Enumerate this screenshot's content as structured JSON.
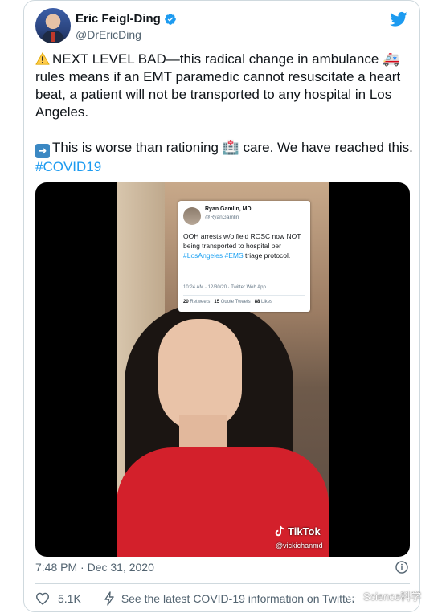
{
  "tweet": {
    "author_name": "Eric Feigl-Ding",
    "author_handle": "@DrEricDing",
    "paragraph1": "NEXT LEVEL BAD—this radical change in ambulance 🚑 rules means if an EMT paramedic cannot resuscitate a heart beat, a patient will not be transported to any hospital in Los Angeles.",
    "paragraph2_a": "This is worse than rationing 🏥 care. We have reached this. ",
    "hashtag": "#COVID19",
    "timestamp": "7:48 PM · Dec 31, 2020",
    "likes": "5.1K",
    "covid_link": "See the latest COVID-19 information on Twitter"
  },
  "embedded_tweet": {
    "name": "Ryan Gamlin, MD",
    "handle": "@RyanGamlin",
    "text_a": "OOH arrests w/o field ROSC now NOT being transported to hospital per ",
    "hashtag1": "#LosAngeles",
    "hashtag2": "#EMS",
    "text_b": " triage protocol.",
    "time": "10:24 AM · 12/30/20 · Twitter Web App",
    "retweets": "20",
    "retweets_label": "Retweets",
    "quotes": "15",
    "quotes_label": "Quote Tweets",
    "likes": "88",
    "likes_label": "Likes"
  },
  "video_overlay": {
    "tiktok_label": "TikTok",
    "tiktok_handle": "@vickichanmd"
  },
  "watermark": "Science科学",
  "colors": {
    "link": "#1d9bf0",
    "border": "#cfd9de",
    "muted": "#536471",
    "shirt": "#d3202b"
  },
  "icons": [
    "verified-badge-icon",
    "twitter-bird-icon",
    "warning-icon",
    "right-arrow-icon",
    "info-icon",
    "heart-icon",
    "lightning-icon",
    "tiktok-icon",
    "wechat-icon"
  ]
}
